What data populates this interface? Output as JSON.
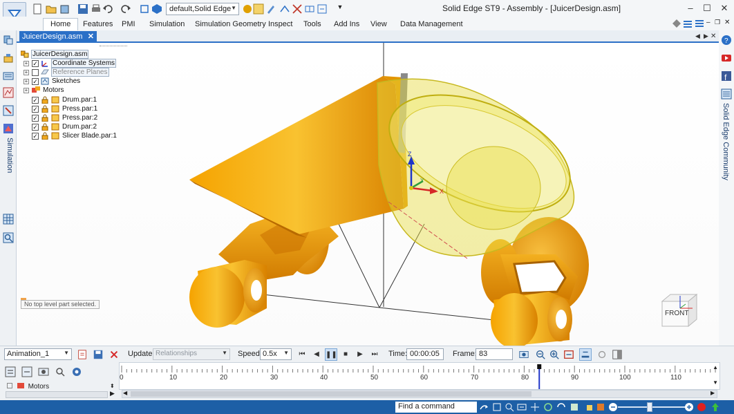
{
  "titlebar": {
    "window_title": "Solid Edge ST9 - Assembly - [JuicerDesign.asm]",
    "style_select": "default,Solid Edge",
    "controls": {
      "minimize": "–",
      "maximize": "☐",
      "close": "✕"
    }
  },
  "ribbon": {
    "tabs": [
      {
        "label": "Home",
        "active": true
      },
      {
        "label": "Features"
      },
      {
        "label": "PMI"
      },
      {
        "label": "Simulation"
      },
      {
        "label": "Simulation Geometry"
      },
      {
        "label": "Inspect"
      },
      {
        "label": "Tools"
      },
      {
        "label": "Add Ins"
      },
      {
        "label": "View"
      },
      {
        "label": "Data Management"
      }
    ]
  },
  "left_dock": {
    "simulation_label": "Simulation"
  },
  "right_dock": {
    "community_label": "Solid Edge Community"
  },
  "document_tab": {
    "label": "JuicerDesign.asm",
    "close": "✕"
  },
  "pathfinder": {
    "root": "JuicerDesign.asm",
    "items": [
      {
        "label": "Coordinate Systems",
        "checked": true,
        "expandable": true,
        "boxed": true
      },
      {
        "label": "Reference Planes",
        "checked": false,
        "expandable": true,
        "gray": true
      },
      {
        "label": "Sketches",
        "checked": true,
        "expandable": true
      },
      {
        "label": "Motors",
        "expandable": true,
        "no_checkbox": true
      },
      {
        "label": "Drum.par:1",
        "checked": true
      },
      {
        "label": "Press.par:1",
        "checked": true
      },
      {
        "label": "Press.par:2",
        "checked": true
      },
      {
        "label": "Drum.par:2",
        "checked": true
      },
      {
        "label": "Slicer Blade.par:1",
        "checked": true
      }
    ]
  },
  "viewport": {
    "status_note": "No top level part selected.",
    "view_cube_label": "FRONT",
    "axes": {
      "x": "X",
      "y": "Y",
      "z": "Z"
    }
  },
  "animation_bar": {
    "animation_select": "Animation_1",
    "update_label": "Update:",
    "update_value": "Relationships",
    "speed_label": "Speed:",
    "speed_value": "0.5x",
    "time_label": "Time:",
    "time_value": "00:00:05",
    "frame_label": "Frame:",
    "frame_value": "83"
  },
  "timeline": {
    "ticks": [
      "0",
      "10",
      "20",
      "30",
      "40",
      "50",
      "60",
      "70",
      "80",
      "90",
      "100",
      "110"
    ],
    "current_frame": 83,
    "tree_label": "Motors"
  },
  "statusbar": {
    "find_command": "Find a command"
  },
  "colors": {
    "accent": "#2b70c7",
    "statusbar": "#1d5fa6",
    "part_gold": "#f0a010",
    "transparent_drum": "#e8e060"
  }
}
